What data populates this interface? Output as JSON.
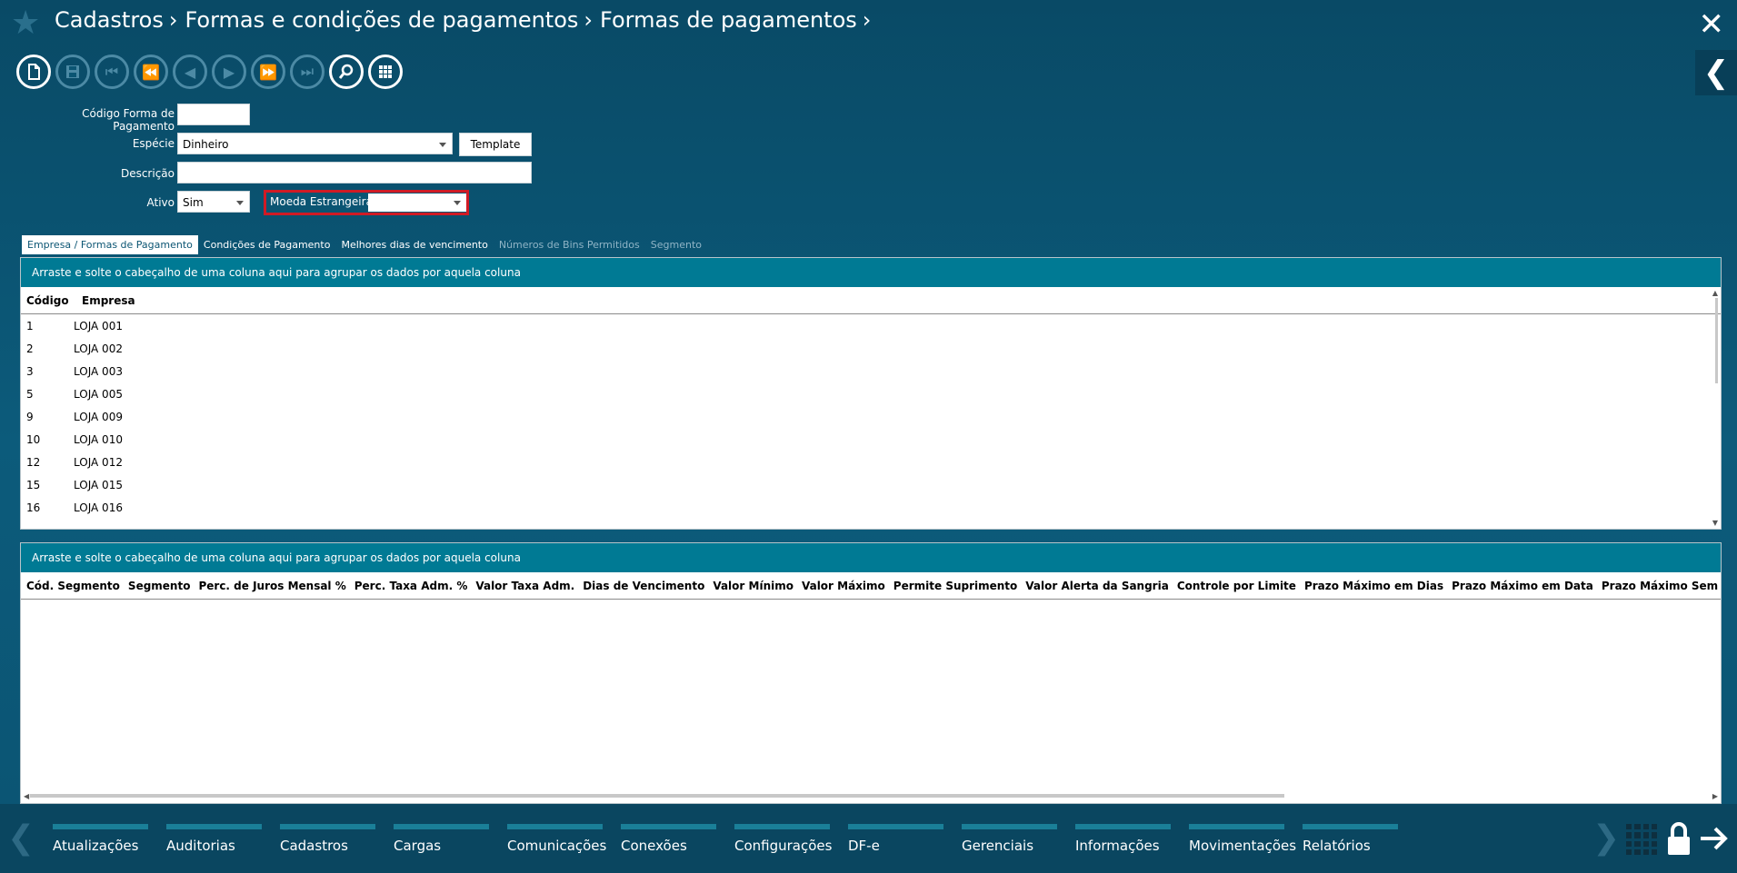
{
  "header": {
    "breadcrumb": [
      "Cadastros",
      "Formas e condições de pagamentos",
      "Formas de pagamentos"
    ]
  },
  "form": {
    "codigo_label": "Código Forma de Pagamento",
    "codigo_value": "",
    "especie_label": "Espécie",
    "especie_value": "Dinheiro",
    "template_label": "Template",
    "descricao_label": "Descrição",
    "descricao_value": "",
    "ativo_label": "Ativo",
    "ativo_value": "Sim",
    "moeda_label": "Moeda Estrangeira",
    "moeda_value": ""
  },
  "tabs": [
    {
      "label": "Empresa / Formas de Pagamento",
      "state": "active"
    },
    {
      "label": "Condições de Pagamento",
      "state": "normal"
    },
    {
      "label": "Melhores dias de vencimento",
      "state": "normal"
    },
    {
      "label": "Números de Bins Permitidos",
      "state": "disabled"
    },
    {
      "label": "Segmento",
      "state": "disabled"
    }
  ],
  "grid1": {
    "group_hint": "Arraste e solte o cabeçalho de uma coluna aqui para agrupar os dados por aquela coluna",
    "columns": [
      "Código",
      "Empresa"
    ],
    "rows": [
      [
        "1",
        "LOJA 001"
      ],
      [
        "2",
        "LOJA 002"
      ],
      [
        "3",
        "LOJA 003"
      ],
      [
        "5",
        "LOJA 005"
      ],
      [
        "9",
        "LOJA 009"
      ],
      [
        "10",
        "LOJA 010"
      ],
      [
        "12",
        "LOJA 012"
      ],
      [
        "15",
        "LOJA 015"
      ],
      [
        "16",
        "LOJA 016"
      ]
    ]
  },
  "grid2": {
    "group_hint": "Arraste e solte o cabeçalho de uma coluna aqui para agrupar os dados por aquela coluna",
    "columns": [
      "Cód. Segmento",
      "Segmento",
      "Perc. de Juros Mensal %",
      "Perc. Taxa Adm. %",
      "Valor Taxa Adm.",
      "Dias de Vencimento",
      "Valor Mínimo",
      "Valor Máximo",
      "Permite Suprimento",
      "Valor Alerta da Sangria",
      "Controle por Limite",
      "Prazo Máximo em Dias",
      "Prazo Máximo em Data",
      "Prazo Máximo Sem Juros em Dias"
    ]
  },
  "bottom_menu": [
    "Atualizações",
    "Auditorias",
    "Cadastros",
    "Cargas",
    "Comunicações",
    "Conexões",
    "Configurações",
    "DF-e",
    "Gerenciais",
    "Informações",
    "Movimentações",
    "Relatórios"
  ],
  "colors": {
    "background": "#0b5573",
    "group_bar": "#007a94",
    "highlight_border": "#d01b25",
    "menu_bar": "#1a7f98"
  }
}
